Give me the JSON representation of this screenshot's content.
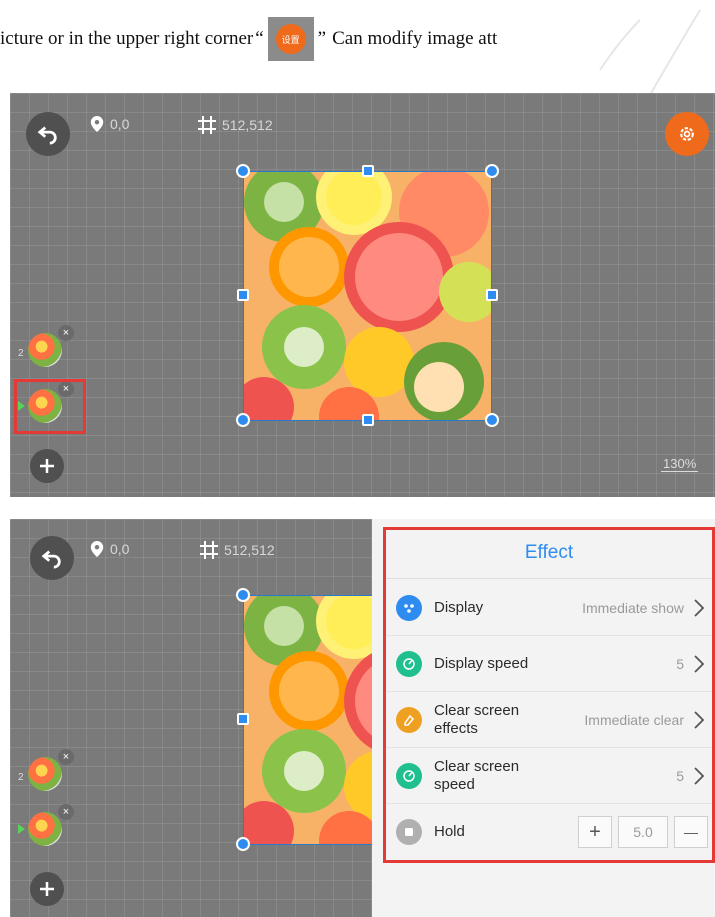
{
  "doc": {
    "text_before": "icture or in the upper right corner",
    "open_quote": "“",
    "settings_icon_label": "设置",
    "close_quote": "”",
    "text_after": "Can modify image att"
  },
  "canvas": {
    "position": "0,0",
    "size": "512,512",
    "zoom": "130%",
    "layers": [
      {
        "number": "2",
        "close": "×"
      },
      {
        "number": "",
        "close": "×"
      }
    ]
  },
  "effect_panel": {
    "title": "Effect",
    "rows": [
      {
        "label": "Display",
        "value": "Immediate show",
        "icon": "dots-icon",
        "color": "#2e8cf0"
      },
      {
        "label": "Display speed",
        "value": "5",
        "icon": "speedometer-icon",
        "color": "#1fbf8f"
      },
      {
        "label": "Clear screen effects",
        "value": "Immediate clear",
        "icon": "eraser-icon",
        "color": "#f0a020"
      },
      {
        "label": "Clear screen speed",
        "value": "5",
        "icon": "speedometer-icon",
        "color": "#1fbf8f"
      }
    ],
    "hold": {
      "label": "Hold",
      "value": "5.0",
      "plus": "+",
      "minus": "—",
      "icon": "stop-icon",
      "color": "#b0b0b0"
    }
  },
  "colors": {
    "accent": "#f06a1c",
    "selection": "#2e8cf0",
    "highlight": "#e53935"
  }
}
